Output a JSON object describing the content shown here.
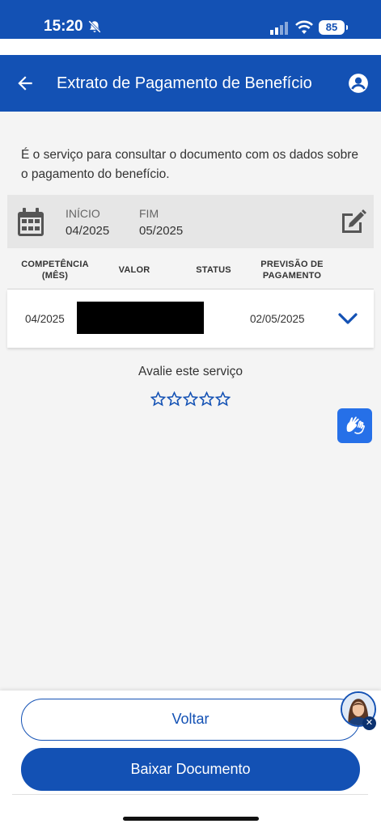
{
  "status_bar": {
    "time": "15:20",
    "battery": "85"
  },
  "header": {
    "title": "Extrato de Pagamento de Benefício"
  },
  "description": "É o serviço para consultar o documento com os dados sobre o pagamento do benefício.",
  "period": {
    "start_label": "INÍCIO",
    "start_value": "04/2025",
    "end_label": "FIM",
    "end_value": "05/2025"
  },
  "table": {
    "headers": {
      "competencia": "COMPETÊNCIA\n(MÊS)",
      "valor": "VALOR",
      "status": "STATUS",
      "previsao": "PREVISÃO DE\nPAGAMENTO"
    },
    "rows": [
      {
        "competencia": "04/2025",
        "previsao": "02/05/2025"
      }
    ]
  },
  "rating": {
    "label": "Avalie este serviço",
    "stars": 5,
    "selected": 0
  },
  "footer": {
    "back_label": "Voltar",
    "download_label": "Baixar Documento"
  },
  "colors": {
    "primary": "#1351b4",
    "libras": "#2670e8"
  },
  "icons": [
    "back-arrow",
    "user-circle",
    "calendar",
    "edit-pencil",
    "chevron-down",
    "star-outline",
    "sign-language-hands"
  ]
}
